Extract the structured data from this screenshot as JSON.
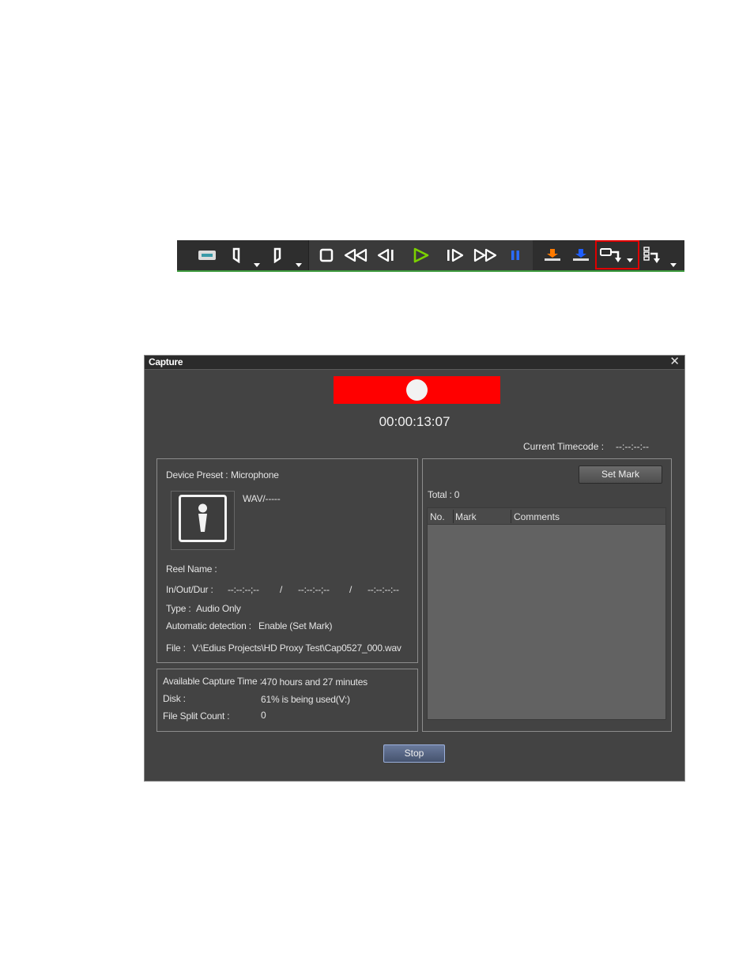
{
  "toolbar": {
    "icons": [
      "tape-icon",
      "mark-in-icon",
      "mark-out-icon",
      "stop-icon",
      "rewind-icon",
      "step-back-icon",
      "play-icon",
      "step-forward-icon",
      "fast-forward-icon",
      "pause-icon",
      "insert-to-timeline-icon",
      "overwrite-to-timeline-icon",
      "capture-icon",
      "batch-capture-icon"
    ],
    "colors": {
      "play": "#7bd000",
      "pause": "#2a6bff",
      "highlight": "#e00000"
    }
  },
  "dialog": {
    "title": "Capture",
    "close": "✕",
    "timecode": "00:00:13:07",
    "current_timecode_label": "Current Timecode :",
    "current_timecode_value": "--:--:--:--",
    "device_preset_label": "Device Preset :",
    "device_preset_value": "Microphone",
    "format": "WAV/-----",
    "reel_name_label": "Reel Name :",
    "inoutdur_label": "In/Out/Dur :",
    "in_value": "--:--:--;--",
    "sep1": "/",
    "out_value": "--:--:--;--",
    "sep2": "/",
    "dur_value": "--:--:--:--",
    "type_label": "Type :",
    "type_value": "Audio Only",
    "auto_detect_label": "Automatic detection :",
    "auto_detect_value": "Enable (Set Mark)",
    "file_label": "File :",
    "file_value": "V:\\Edius Projects\\HD Proxy Test\\Cap0527_000.wav",
    "avail_label": "Available Capture Time :",
    "avail_value": "470 hours and 27 minutes",
    "disk_label": "Disk :",
    "disk_value": "61% is being used(V:)",
    "split_label": "File Split Count :",
    "split_value": "0",
    "set_mark_label": "Set Mark",
    "total_label": "Total : 0",
    "columns": [
      "No.",
      "Mark",
      "Comments"
    ],
    "stop_label": "Stop",
    "rec_color": "#ff0000"
  }
}
